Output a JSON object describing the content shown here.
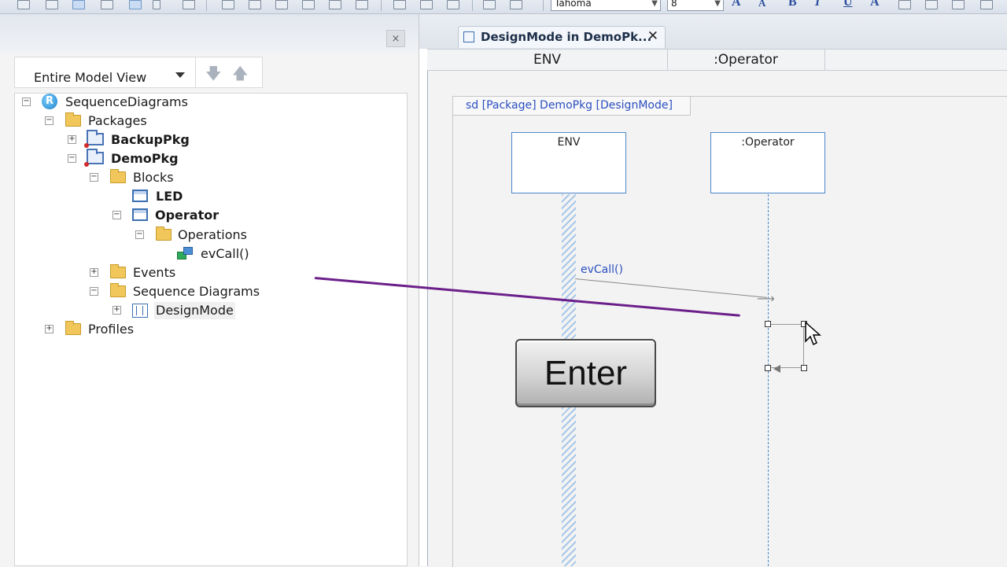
{
  "toolbar": {
    "font_name": "Tahoma",
    "font_size": "8",
    "format_glyphs": [
      "A",
      "A",
      "B",
      "I",
      "U",
      "A"
    ]
  },
  "browser": {
    "close_glyph": "×",
    "view_selector": "Entire Model View",
    "nav_down": "🡇",
    "nav_up": "🡅",
    "tree": {
      "root": "SequenceDiagrams",
      "packages": "Packages",
      "backup_pkg": "BackupPkg",
      "demo_pkg": "DemoPkg",
      "blocks": "Blocks",
      "led": "LED",
      "operator": "Operator",
      "operations": "Operations",
      "ev_call": "evCall()",
      "events": "Events",
      "sequence_diagrams": "Sequence Diagrams",
      "design_mode": "DesignMode",
      "profiles": "Profiles"
    }
  },
  "editor": {
    "tab_title": "DesignMode in DemoPk...",
    "tab_close": "✕",
    "header_columns": [
      "ENV",
      ":Operator"
    ],
    "frame_label": "sd [Package] DemoPkg [DesignMode]",
    "lifelines": [
      "ENV",
      ":Operator"
    ],
    "message_label": "evCall()"
  },
  "overlay": {
    "key_label": "Enter"
  },
  "colors": {
    "annotation": "#6b1f8a",
    "diagram_text": "#2b4fc0",
    "lifeline_border": "#4a86c9"
  }
}
